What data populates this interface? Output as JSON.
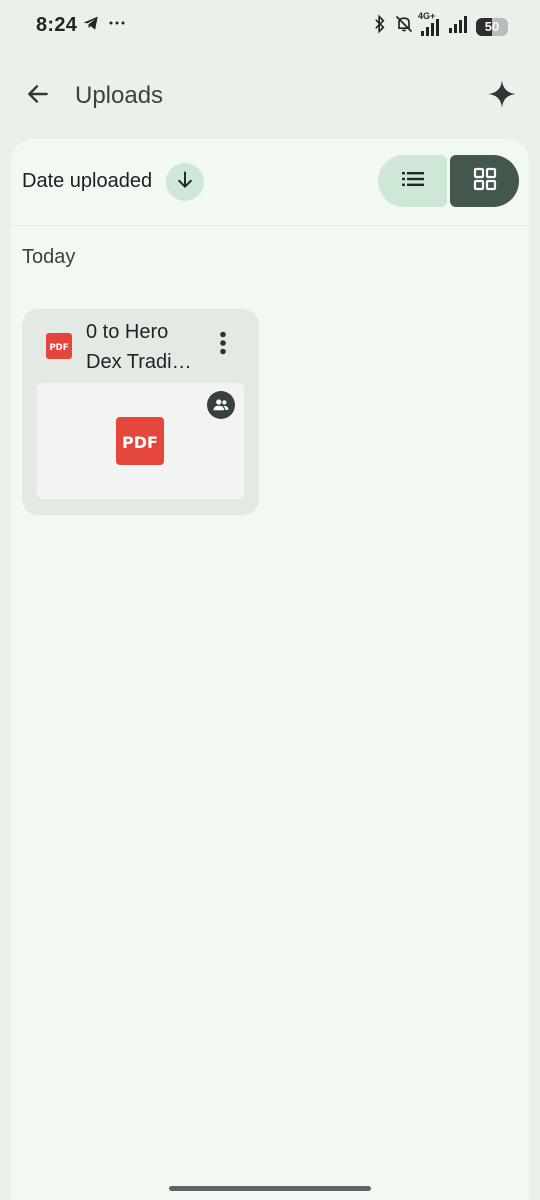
{
  "status_bar": {
    "time": "8:24",
    "network": "4G+",
    "battery": "50",
    "battery_level": 0.5,
    "icons": [
      "telegram-icon",
      "more-notifications-icon",
      "bluetooth-icon",
      "silent-icon",
      "signal-icon",
      "battery-icon"
    ]
  },
  "app_bar": {
    "title": "Uploads",
    "back_icon": "arrow-back-icon",
    "action_icon": "sparkle-icon"
  },
  "sort": {
    "label": "Date uploaded",
    "direction_icon": "arrow-down-icon"
  },
  "view_toggle": {
    "list_icon": "list-icon",
    "grid_icon": "grid-icon",
    "selected": "grid"
  },
  "section": {
    "label": "Today"
  },
  "files": [
    {
      "name_line1": "0 to Hero",
      "name_line2": "Dex Tradi…",
      "type_label": "PDF",
      "thumb_label": "PDF",
      "shared": true
    }
  ],
  "colors": {
    "background": "#eaf1ea",
    "panel": "#f2f8f2",
    "accent_light": "#cfe7d6",
    "accent_dark": "#43574c",
    "pdf_red": "#e5463c"
  }
}
